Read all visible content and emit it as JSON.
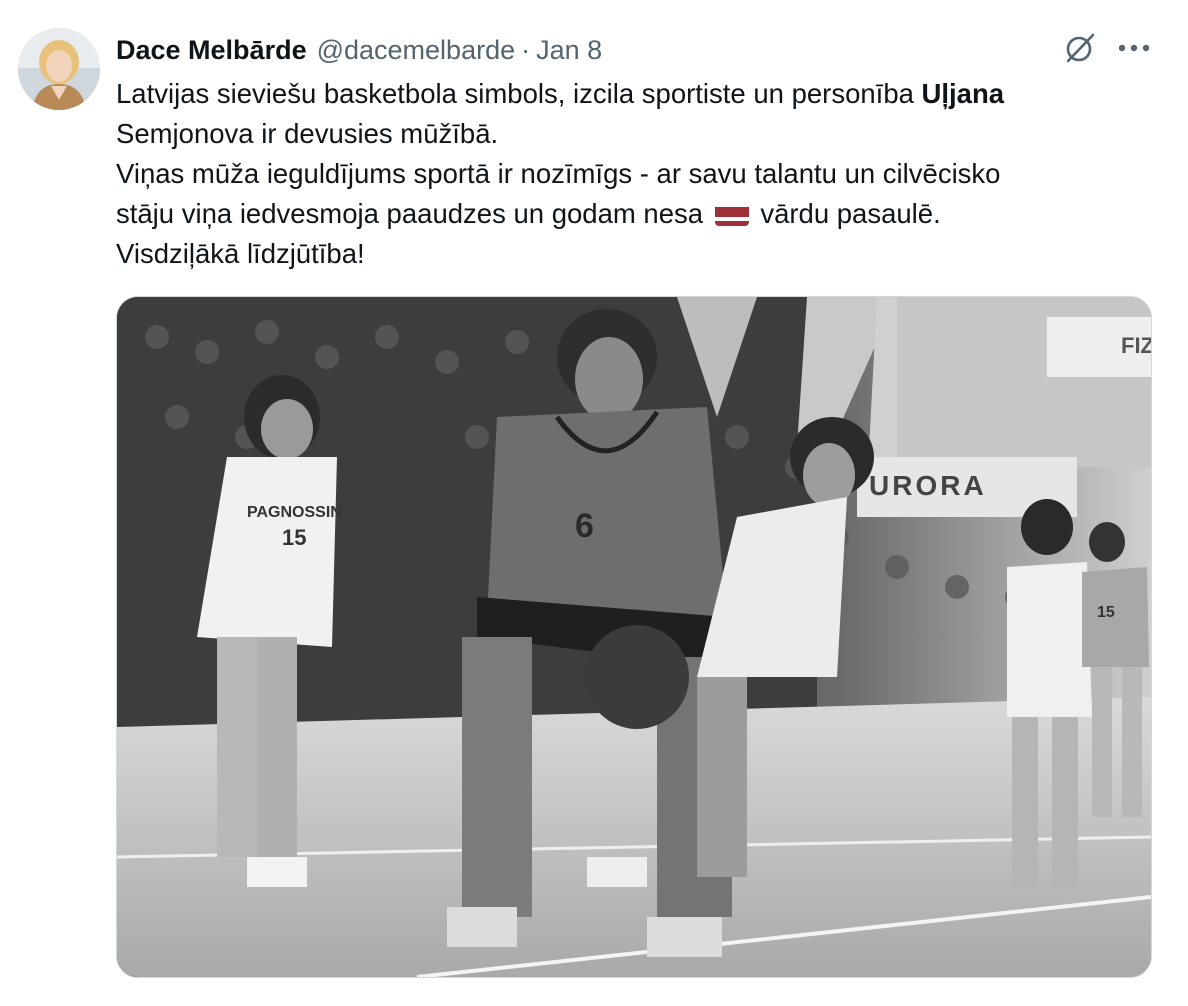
{
  "tweet": {
    "author_name": "Dace Melbārde",
    "author_handle": "@dacemelbarde",
    "separator": "·",
    "date": "Jan 8",
    "text_lines": {
      "l1_pre": "Latvijas sieviešu basketbola simbols, izcila sportiste un personība ",
      "l1_bold": "Uļjana",
      "l2": "Semjonova ir devusies mūžībā.",
      "l3": "Viņas mūža ieguldījums sportā ir nozīmīgs - ar savu talantu un cilvēcisko",
      "l4_pre": "stāju viņa iedvesmoja paaudzes un godam nesa ",
      "l4_post": " vārdu pasaulē.",
      "l5": "Visdziļākā līdzjūtība!"
    },
    "flag_colors": {
      "top": "#9e3039",
      "middle": "#ffffff",
      "bottom": "#9e3039"
    },
    "icons": {
      "grok": "grok-icon",
      "more": "more-icon",
      "flag": "latvia-flag-icon"
    }
  },
  "photo": {
    "signs": {
      "arena": "URORA",
      "corner": "FIZ"
    },
    "jerseys": {
      "sponsor": "PAGNOSSIN",
      "number_left": "15",
      "number_center": "6",
      "number_right": "15"
    }
  }
}
